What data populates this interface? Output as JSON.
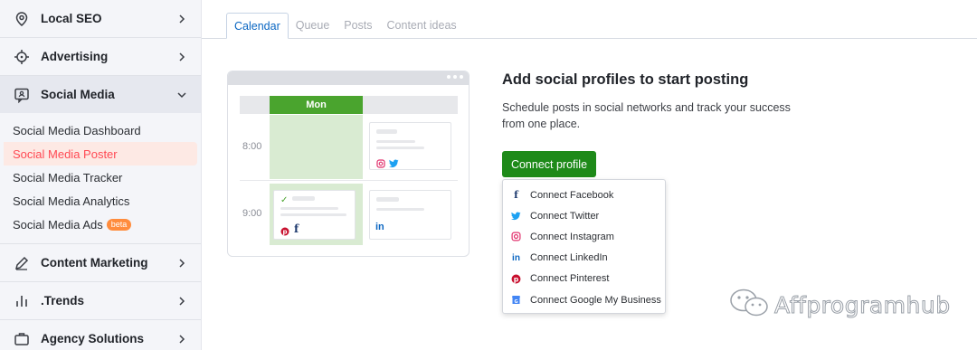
{
  "sidebar": {
    "sections": [
      {
        "label": "Local SEO",
        "icon": "map-pin-icon"
      },
      {
        "label": "Advertising",
        "icon": "crosshair-icon"
      },
      {
        "label": "Social Media",
        "icon": "chat-bubble-icon"
      },
      {
        "label": "Content Marketing",
        "icon": "pencil-icon"
      },
      {
        "label": ".Trends",
        "icon": "bar-chart-icon"
      },
      {
        "label": "Agency Solutions",
        "icon": "briefcase-icon"
      }
    ],
    "social_items": [
      {
        "label": "Social Media Dashboard"
      },
      {
        "label": "Social Media Poster"
      },
      {
        "label": "Social Media Tracker"
      },
      {
        "label": "Social Media Analytics"
      },
      {
        "label": "Social Media Ads"
      }
    ],
    "beta_label": "beta",
    "active_item": "Social Media Poster"
  },
  "tabs": [
    "Calendar",
    "Queue",
    "Posts",
    "Content ideas"
  ],
  "active_tab": "Calendar",
  "illustration": {
    "day": "Mon",
    "times": [
      "8:00",
      "9:00"
    ]
  },
  "main": {
    "heading": "Add social profiles to start posting",
    "description": "Schedule posts in social networks and track your success from one place.",
    "connect_button": "Connect profile"
  },
  "dropdown": [
    {
      "label": "Connect Facebook",
      "icon": "facebook-icon",
      "color": "#1e3a6e"
    },
    {
      "label": "Connect Twitter",
      "icon": "twitter-icon",
      "color": "#1da1f2"
    },
    {
      "label": "Connect Instagram",
      "icon": "instagram-icon",
      "color": "#e1306c"
    },
    {
      "label": "Connect LinkedIn",
      "icon": "linkedin-icon",
      "color": "#0a66c2"
    },
    {
      "label": "Connect Pinterest",
      "icon": "pinterest-icon",
      "color": "#c8102e"
    },
    {
      "label": "Connect Google My Business",
      "icon": "google-my-business-icon",
      "color": "#4285f4"
    }
  ],
  "watermark": "Affprogramhub",
  "colors": {
    "accent_green": "#1e8a19",
    "active_red": "#ff4953",
    "tab_blue": "#0a66c2"
  }
}
